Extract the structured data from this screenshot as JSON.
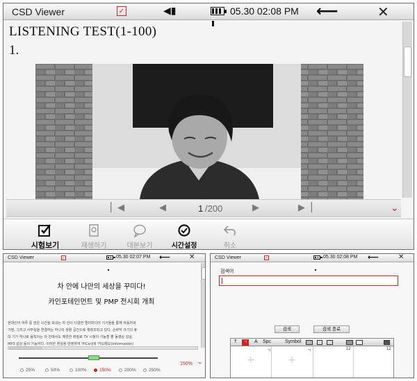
{
  "colors": {
    "accent_red": "#d12020",
    "toolbar_text": "#111111",
    "disabled_text": "#9a9a9a"
  },
  "main": {
    "status": {
      "title": "CSD Viewer",
      "time": "05.30 02:08 PM"
    },
    "doc_title": "LISTENING TEST(1-100)",
    "question_number": "1.",
    "pager": {
      "current": "1",
      "total": "/200"
    },
    "toolbar": [
      {
        "label": "시험보기",
        "icon": "exam-icon",
        "enabled": true
      },
      {
        "label": "재생하기",
        "icon": "play-icon",
        "enabled": false
      },
      {
        "label": "대본보기",
        "icon": "speech-bubble-icon",
        "enabled": false
      },
      {
        "label": "시간설정",
        "icon": "clock-icon",
        "enabled": true
      },
      {
        "label": "취소",
        "icon": "undo-icon",
        "enabled": false
      }
    ]
  },
  "left": {
    "status": {
      "title": "CSD Viewer",
      "time": "05.30 02:07 PM"
    },
    "heading1": "차 안에 나만의 세상을 꾸미다!",
    "heading2": "카인포테인먼트 및 PMP 전시회 개최",
    "body_lines": [
      "현대인이 하루 중 많은 시간을 보내는 차 안이 다양한 멀티미디어 기기들을 통해 자동차와",
      "가정, 그리고 사무실을 연결하는 하나의 생활 공간으로 재창조되고 있다. 손바닥 크기의 휴",
      "대 기기 하나로 움직이는 차 안에서도 깨끗한 화질로 TV 시청이 가능할 뿐 동영상 감상,",
      "MP3 감상 등이 가능하다. 이러한 현상을 반영하여 'PlCar]에 '카오페오(Information)"
    ],
    "zoom_current": "150%",
    "zoom_options": [
      {
        "label": "25%",
        "selected": false
      },
      {
        "label": "50%",
        "selected": false
      },
      {
        "label": "100%",
        "selected": false
      },
      {
        "label": "150%",
        "selected": true
      },
      {
        "label": "200%",
        "selected": false
      },
      {
        "label": "250%",
        "selected": false
      }
    ]
  },
  "right": {
    "status": {
      "title": "CSD Viewer",
      "time": "05.30 02:08 PM"
    },
    "search_label": "검색어",
    "search_value": "",
    "search_button": "검색",
    "search_end_button": "검색 종료",
    "keyboard": {
      "toggle": "A",
      "space": "Spc",
      "symbol": "Symbol",
      "num_a": "12",
      "num_b": "12",
      "char_a": "ㄱ",
      "char_b": "ㄱ"
    }
  }
}
